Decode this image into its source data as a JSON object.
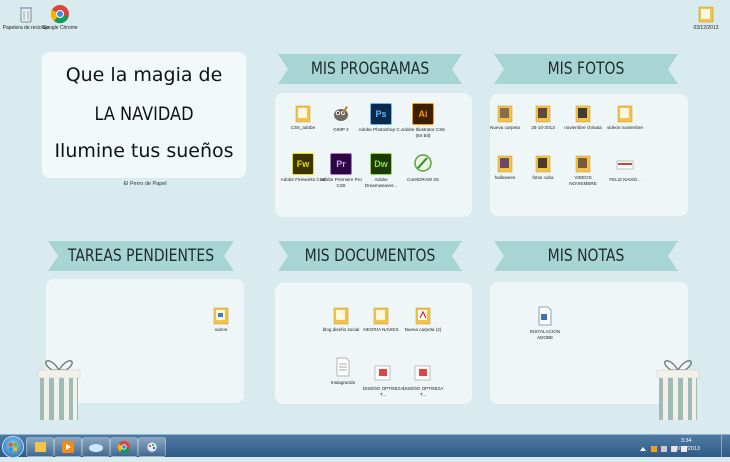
{
  "desktop_icons": [
    {
      "label": "Papelera de reciclaje",
      "icon": "recycle-bin-icon"
    },
    {
      "label": "Google Chrome",
      "icon": "chrome-icon"
    },
    {
      "label": "03/12/2013",
      "icon": "folder-icon"
    }
  ],
  "quote": {
    "line1": "Que la magia de",
    "line2": "LA NAVIDAD",
    "line3": "Ilumine tus sueños",
    "credit": "El Perro de Papel"
  },
  "sections": {
    "programas": {
      "title": "MIS PROGRAMAS",
      "items": [
        {
          "label": "CS5_adobe",
          "icon": "folder-icon"
        },
        {
          "label": "GIMP 2",
          "icon": "gimp-icon"
        },
        {
          "label": "Adobe Photoshop C...",
          "icon": "photoshop-icon",
          "abbr": "Ps"
        },
        {
          "label": "Adobe Illustrator CS6 (64 Bit)",
          "icon": "illustrator-icon",
          "abbr": "Ai"
        },
        {
          "label": "Adobe Fireworks CS6",
          "icon": "fireworks-icon",
          "abbr": "Fw"
        },
        {
          "label": "Adobe Premiere Pro CS6",
          "icon": "premiere-icon",
          "abbr": "Pr"
        },
        {
          "label": "Adobe Dreamweaver...",
          "icon": "dreamweaver-icon",
          "abbr": "Dw"
        },
        {
          "label": "CorelDRAW X5",
          "icon": "coreldraw-icon"
        }
      ]
    },
    "fotos": {
      "title": "MIS FOTOS",
      "items": [
        {
          "label": "Nueva carpeta",
          "icon": "folder-icon"
        },
        {
          "label": "25-10-2013",
          "icon": "folder-icon"
        },
        {
          "label": "noviembre chinata",
          "icon": "folder-icon"
        },
        {
          "label": "videos noviembre",
          "icon": "folder-icon"
        },
        {
          "label": "halloween",
          "icon": "folder-icon"
        },
        {
          "label": "fotos cuba",
          "icon": "folder-icon"
        },
        {
          "label": "VIDEOS NOVIEMBRE",
          "icon": "folder-icon"
        },
        {
          "label": "FELIZ NAVID...",
          "icon": "image-file-icon"
        }
      ]
    },
    "tareas": {
      "title": "TAREAS PENDIENTES",
      "items": [
        {
          "label": "varios",
          "icon": "folder-icon"
        }
      ]
    },
    "documentos": {
      "title": "MIS DOCUMENTOS",
      "items": [
        {
          "label": "blog diseño social",
          "icon": "folder-icon"
        },
        {
          "label": "NEGRIA NAVIES",
          "icon": "folder-icon"
        },
        {
          "label": "Nueva carpeta (2)",
          "icon": "pdf-folder-icon"
        },
        {
          "label": "Instagrando",
          "icon": "text-file-icon"
        },
        {
          "label": "DISEÑO OPTIMIZA T...",
          "icon": "pdf-file-icon"
        },
        {
          "label": "DISEÑO OPTIMIZA T...",
          "icon": "pdf-file-icon"
        }
      ]
    },
    "notas": {
      "title": "MIS NOTAS",
      "items": [
        {
          "label": "INSTALACION ADOBE",
          "icon": "document-file-icon"
        }
      ]
    }
  },
  "taskbar": {
    "apps": [
      "start-button",
      "explorer-icon",
      "media-player-icon",
      "folder-icon",
      "chrome-icon",
      "paint-icon"
    ],
    "time": "3:34",
    "date": "03/12/2013"
  },
  "colors": {
    "banner": "#a6d5d3",
    "panel": "#eef6f7",
    "desktop": "#d9ebee",
    "folder": "#f2c24a"
  }
}
